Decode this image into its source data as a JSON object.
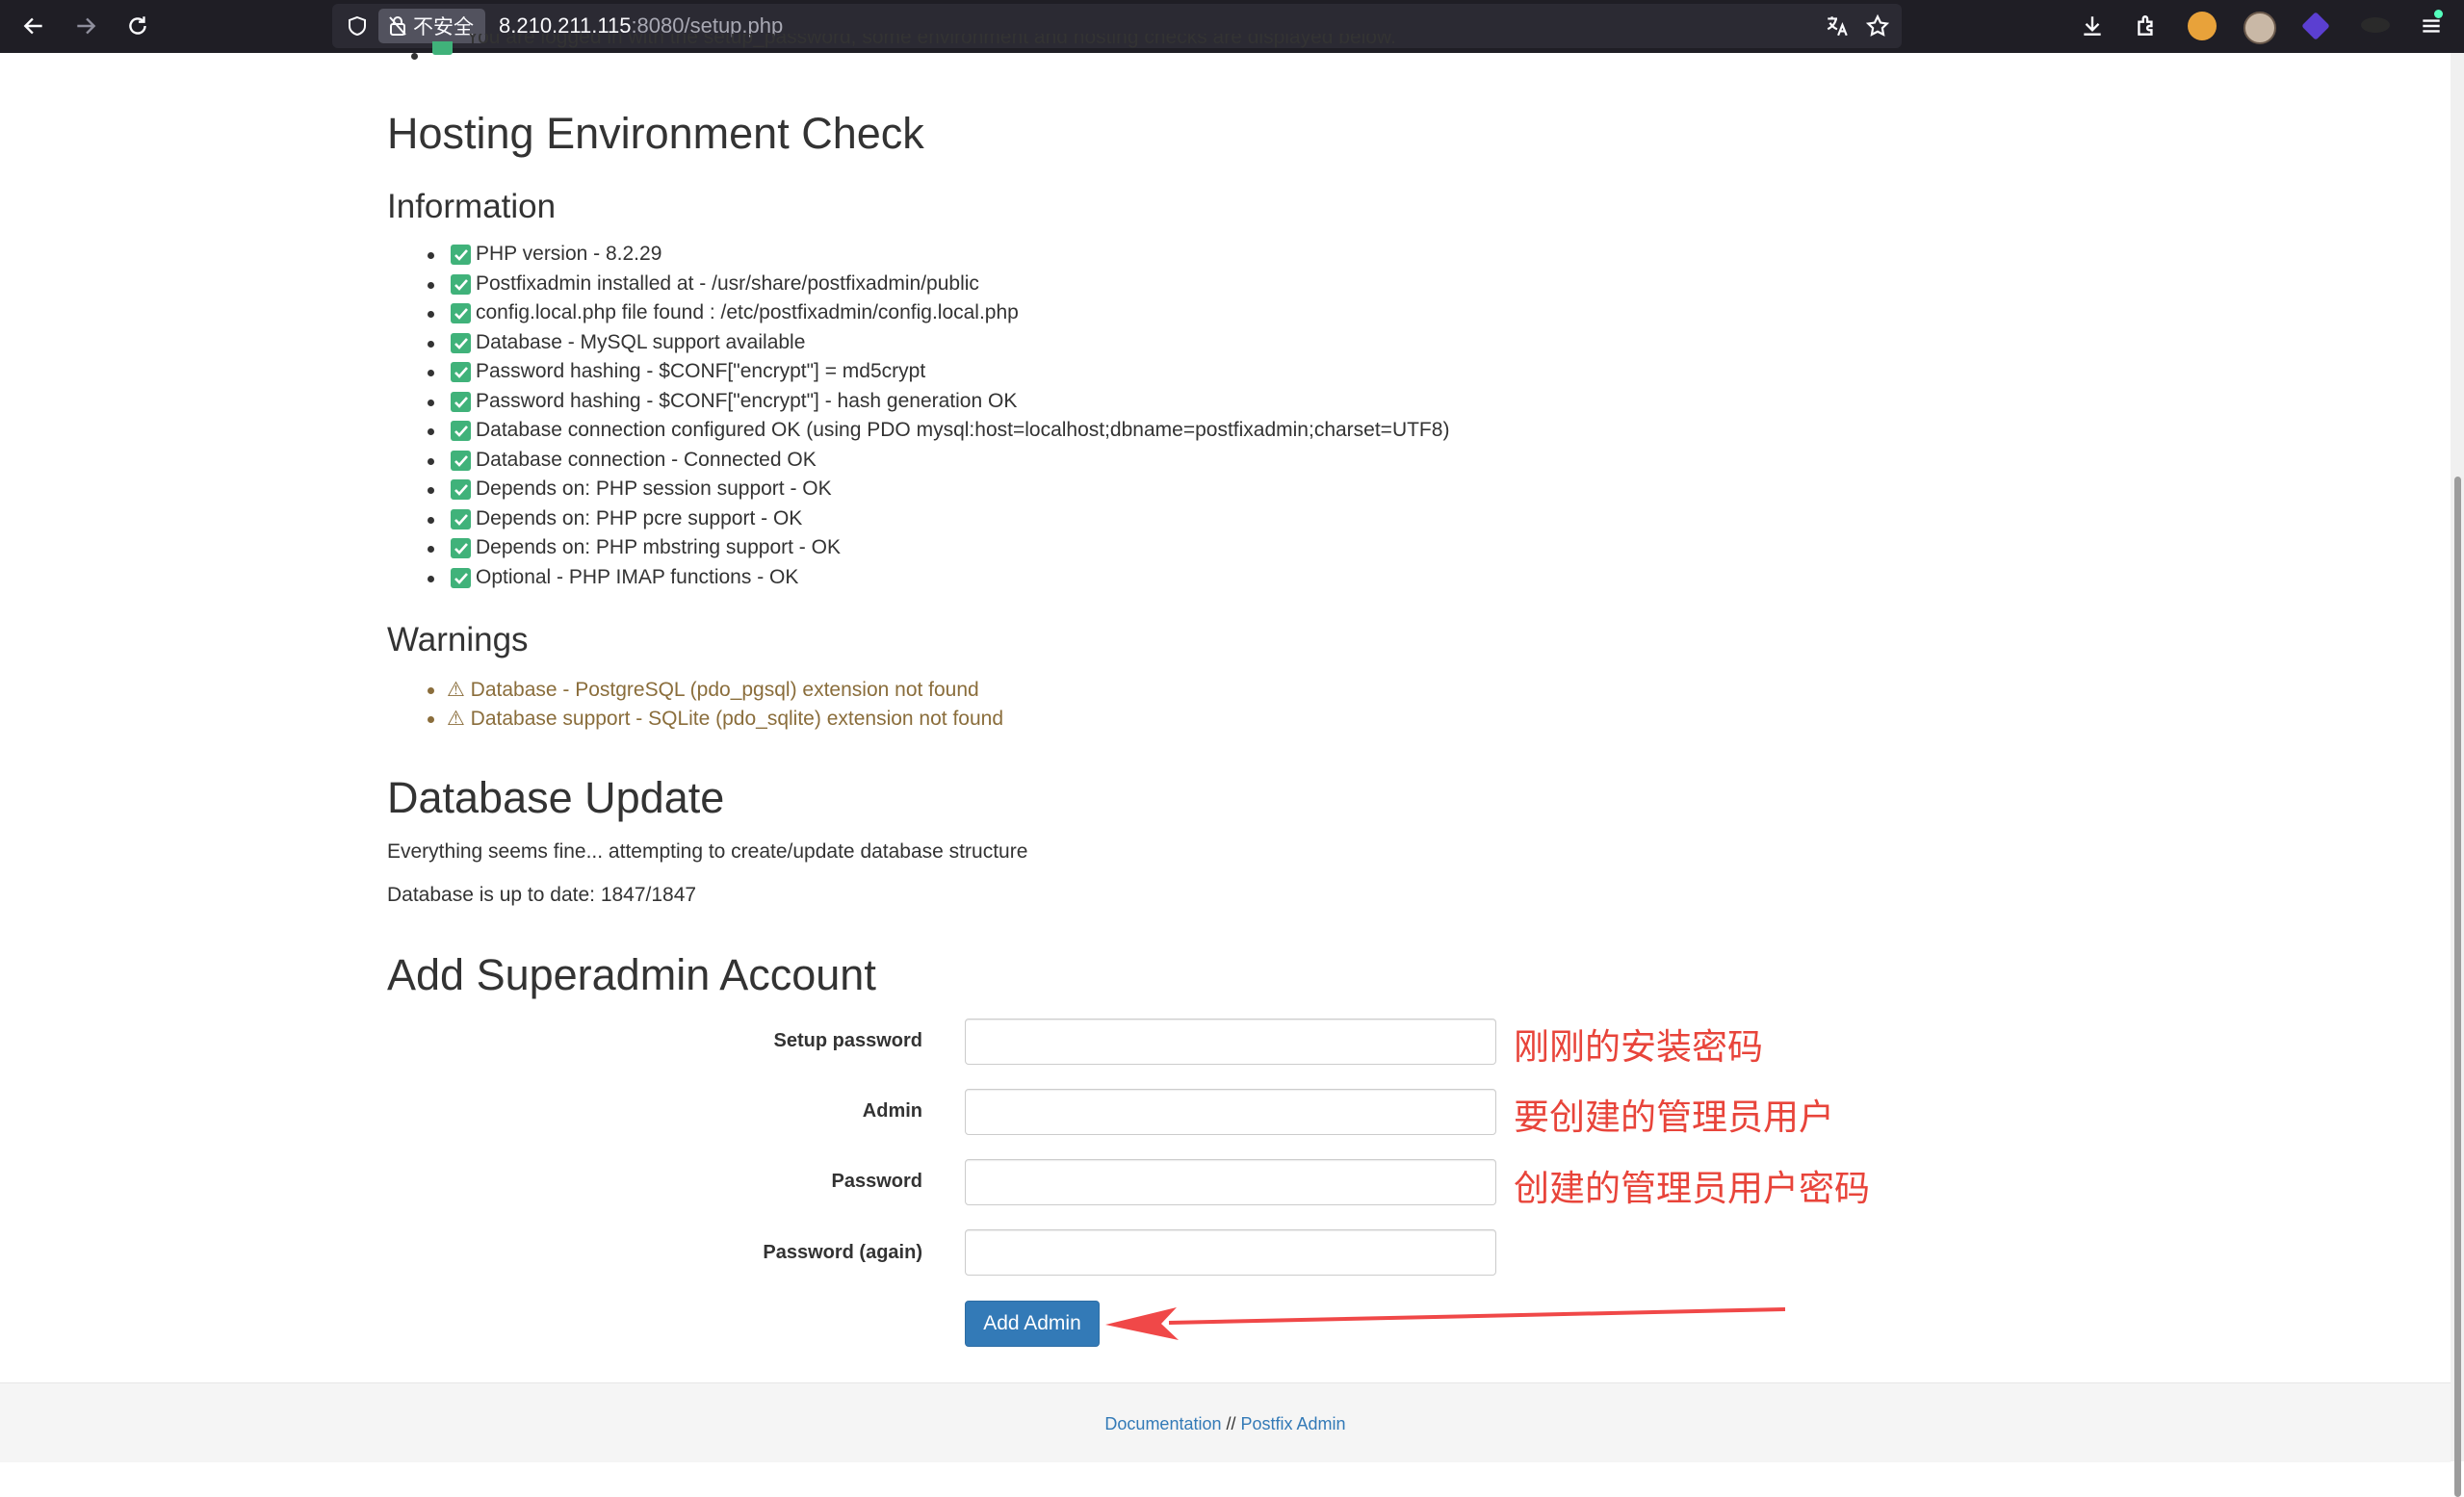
{
  "browser": {
    "insecure_label": "不安全",
    "url_host": "8.210.211.115",
    "url_rest": ":8080/setup.php"
  },
  "page": {
    "cut_off_line": "You are logged in with the setup_password, some environment and hosting checks are displayed below.",
    "hosting_title": "Hosting Environment Check",
    "information_title": "Information",
    "info_items": [
      "PHP version - 8.2.29",
      "Postfixadmin installed at - /usr/share/postfixadmin/public",
      "config.local.php file found : /etc/postfixadmin/config.local.php",
      "Database - MySQL support available",
      "Password hashing - $CONF[\"encrypt\"] = md5crypt",
      "Password hashing - $CONF[\"encrypt\"] - hash generation OK",
      "Database connection configured OK (using PDO mysql:host=localhost;dbname=postfixadmin;charset=UTF8)",
      "Database connection - Connected OK",
      "Depends on: PHP session support - OK",
      "Depends on: PHP pcre support - OK",
      "Depends on: PHP mbstring support - OK",
      "Optional - PHP IMAP functions - OK"
    ],
    "warnings_title": "Warnings",
    "warning_items": [
      "⚠ Database - PostgreSQL (pdo_pgsql) extension not found",
      "⚠ Database support - SQLite (pdo_sqlite) extension not found"
    ],
    "db_update_title": "Database Update",
    "db_update_text1": "Everything seems fine... attempting to create/update database structure",
    "db_update_text2": "Database is up to date: 1847/1847",
    "superadmin_title": "Add Superadmin Account",
    "form": {
      "setup_password_label": "Setup password",
      "setup_password_value": "",
      "admin_label": "Admin",
      "admin_value": "",
      "password_label": "Password",
      "password_value": "",
      "password_again_label": "Password (again)",
      "password_again_value": "",
      "submit_label": "Add Admin"
    },
    "annotations": {
      "setup_password": "刚刚的安装密码",
      "admin": "要创建的管理员用户",
      "password": "创建的管理员用户密码"
    }
  },
  "footer": {
    "documentation": "Documentation",
    "separator": " // ",
    "postfix_admin": "Postfix Admin"
  },
  "colors": {
    "accent": "#337ab7",
    "success": "#40b27a",
    "warning": "#8a6d3b",
    "annotation": "#e8443a"
  }
}
